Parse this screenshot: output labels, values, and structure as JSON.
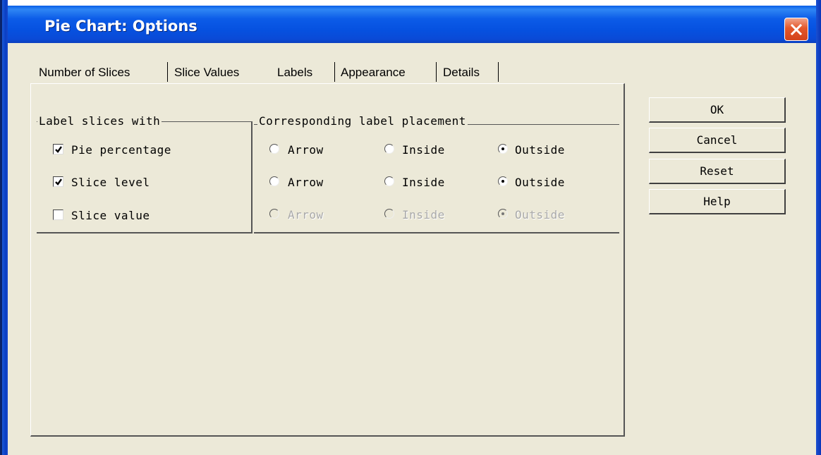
{
  "window": {
    "title": "Pie Chart: Options"
  },
  "tabs": [
    {
      "label": "Number of Slices"
    },
    {
      "label": "Slice Values"
    },
    {
      "label": "Labels",
      "selected": true
    },
    {
      "label": "Appearance"
    },
    {
      "label": "Details"
    }
  ],
  "label_group": {
    "legend": "Label slices with",
    "items": [
      {
        "label": "Pie percentage",
        "checked": true
      },
      {
        "label": "Slice level",
        "checked": true
      },
      {
        "label": "Slice value",
        "checked": false
      }
    ]
  },
  "placement_group": {
    "legend": "Corresponding label placement",
    "rows": [
      {
        "options": [
          "Arrow",
          "Inside",
          "Outside"
        ],
        "selected": "Outside",
        "enabled": true
      },
      {
        "options": [
          "Arrow",
          "Inside",
          "Outside"
        ],
        "selected": "Outside",
        "enabled": true
      },
      {
        "options": [
          "Arrow",
          "Inside",
          "Outside"
        ],
        "selected": "Outside",
        "enabled": false
      }
    ]
  },
  "buttons": {
    "ok": "OK",
    "cancel": "Cancel",
    "reset": "Reset",
    "help": "Help"
  },
  "colors": {
    "titlebar": "#0a5ee8",
    "face": "#ece9d8",
    "close": "#e4572a"
  }
}
